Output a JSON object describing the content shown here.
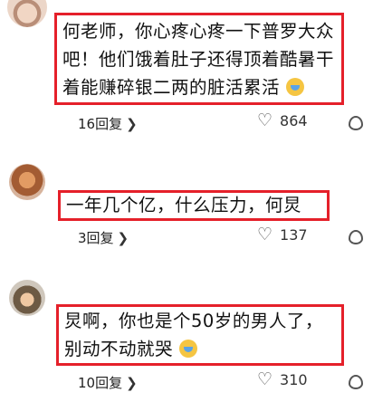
{
  "comments": [
    {
      "text_line1": "何老师，你心疼心疼一下普罗大众",
      "text_line2": "吧！他们饿着肚子还得顶着酷暑干",
      "text_line3": "着能赚碎银二两的脏活累活",
      "emoji_icon": "crying-face",
      "reply_label": "16回复",
      "likes": "864"
    },
    {
      "text_line1": "一年几个亿，什么压力，何炅",
      "reply_label": "3回复",
      "likes": "137"
    },
    {
      "text_line1": "炅啊，你也是个50岁的男人了，",
      "text_line2": "别动不动就哭",
      "emoji_icon": "weary-face",
      "reply_label": "10回复",
      "likes": "310"
    }
  ],
  "icons": {
    "reply_chevron": "chevron-right-icon",
    "like": "heart-outline-icon",
    "dislike": "dislike-heart-icon"
  },
  "colors": {
    "highlight_border": "#e5202a"
  }
}
